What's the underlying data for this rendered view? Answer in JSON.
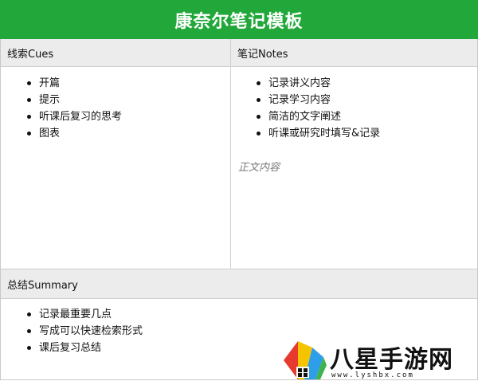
{
  "title": "康奈尔笔记模板",
  "cues": {
    "header": "线索Cues",
    "items": [
      "开篇",
      "提示",
      "听课后复习的思考",
      "图表"
    ]
  },
  "notes": {
    "header": "笔记Notes",
    "items": [
      "记录讲义内容",
      "记录学习内容",
      "简洁的文字阐述",
      "听课或研究时填写&记录"
    ],
    "body_placeholder": "正文内容"
  },
  "summary": {
    "header": "总结Summary",
    "items": [
      "记录最重要几点",
      "写成可以快速检索形式",
      "课后复习总结"
    ]
  },
  "watermark": {
    "title": "八星手游网",
    "url": "www.lyshbx.com"
  },
  "colors": {
    "banner": "#22a83a",
    "header_bg": "#ececec"
  }
}
